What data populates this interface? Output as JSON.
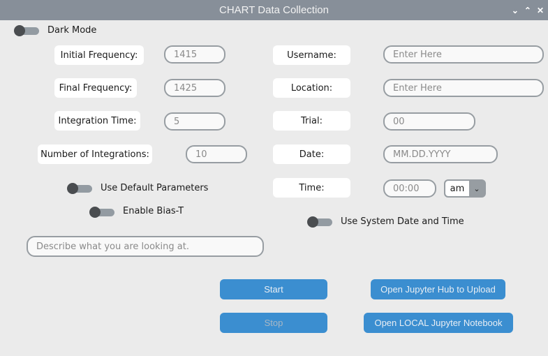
{
  "window": {
    "title": "CHART Data Collection",
    "controls": [
      "⌄",
      "⌃",
      "✕"
    ]
  },
  "dark_mode": {
    "label": "Dark Mode",
    "on": false
  },
  "left_fields": [
    {
      "label": "Initial Frequency:",
      "value": "1415"
    },
    {
      "label": "Final Frequency:",
      "value": "1425"
    },
    {
      "label": "Integration Time:",
      "value": "5"
    },
    {
      "label": "Number of Integrations:",
      "value": "10"
    }
  ],
  "right_fields": [
    {
      "label": "Username:",
      "placeholder": "Enter Here"
    },
    {
      "label": "Location:",
      "placeholder": "Enter Here"
    },
    {
      "label": "Trial:",
      "value": "00"
    },
    {
      "label": "Date:",
      "placeholder": "MM.DD.YYYY"
    },
    {
      "label": "Time:",
      "placeholder": "00:00"
    }
  ],
  "ampm": {
    "selected": "am",
    "icon": "chevron-down-icon"
  },
  "toggles": {
    "default_params": {
      "label": "Use Default Parameters",
      "on": false
    },
    "bias_t": {
      "label": "Enable Bias-T",
      "on": false
    },
    "system_time": {
      "label": "Use System Date and Time",
      "on": false
    }
  },
  "description": {
    "placeholder": "Describe what you are looking at."
  },
  "buttons": {
    "start": "Start",
    "stop": "Stop",
    "hub": "Open Jupyter Hub to Upload",
    "local": "Open LOCAL Jupyter Notebook"
  }
}
